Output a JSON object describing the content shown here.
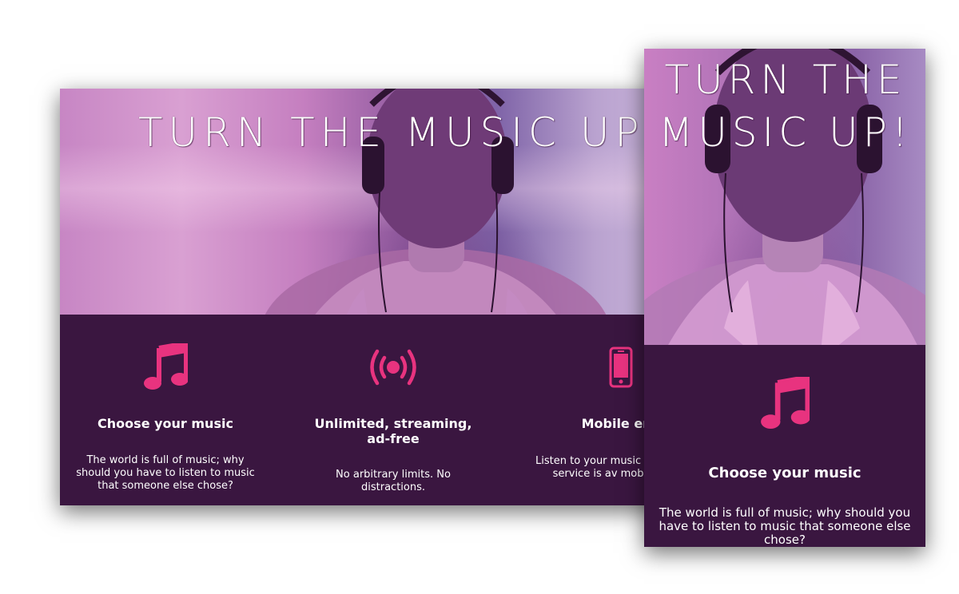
{
  "hero": {
    "title": "TURN THE MUSIC UP!",
    "mobile_title_line1": "TURN THE",
    "mobile_title_line2": "MUSIC UP!"
  },
  "features": [
    {
      "icon": "music-note-icon",
      "title": "Choose your music",
      "text": "The world is full of music; why should you have to listen to music that someone else chose?"
    },
    {
      "icon": "broadcast-icon",
      "title": "Unlimited, streaming, ad-free",
      "text": "No arbitrary limits. No distractions."
    },
    {
      "icon": "mobile-phone-icon",
      "title": "Mobile ena",
      "text": "Listen to your music o streaming service is av mobile platfo"
    }
  ],
  "mobile_features": [
    {
      "icon": "music-note-icon",
      "title": "Choose your music",
      "text": "The world is full of music; why should you have to listen to music that someone else chose?"
    }
  ],
  "colors": {
    "accent": "#e8337f",
    "feature_background": "#3a1640",
    "text": "#ffffff"
  }
}
